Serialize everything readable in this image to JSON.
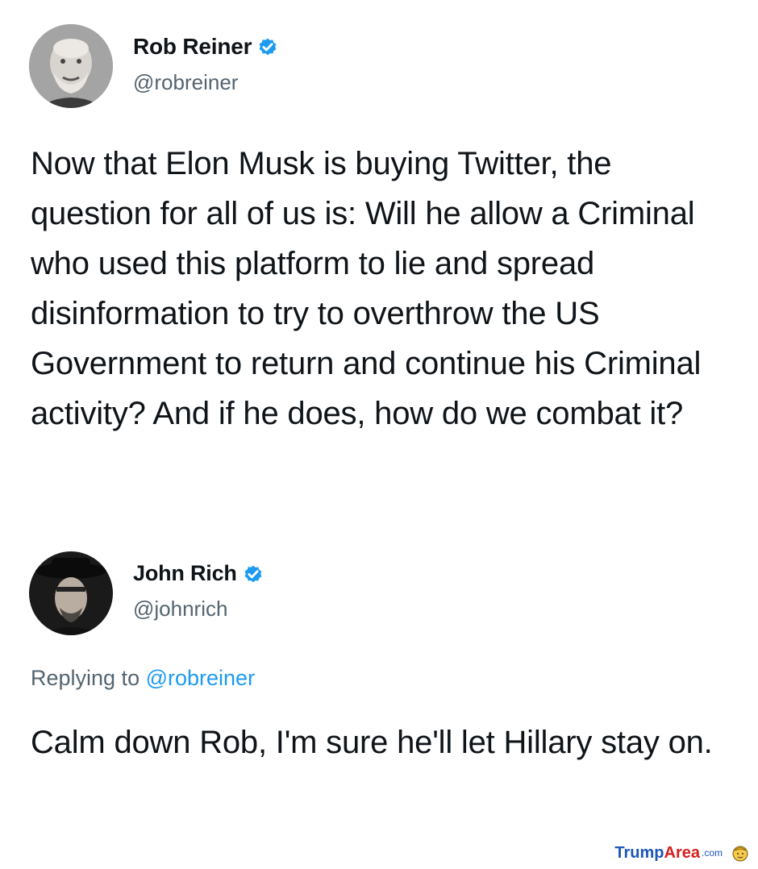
{
  "tweet1": {
    "display_name": "Rob Reiner",
    "handle": "@robreiner",
    "text": "Now that Elon Musk is buying Twitter, the question for all of us is: Will he allow a Criminal who used this platform to lie and spread disinformation to try to overthrow the US Government to return and continue his Criminal activity? And if he does, how do we combat it?"
  },
  "tweet2": {
    "display_name": "John Rich",
    "handle": "@johnrich",
    "replying_prefix": "Replying to ",
    "replying_to": "@robreiner",
    "text": "Calm down Rob, I'm sure he'll let Hillary stay on."
  },
  "watermark": {
    "part1": "Trump",
    "part2": "Area",
    "part3": ".com"
  },
  "icons": {
    "verified": "verified-badge-icon",
    "logo": "trumparea-logo-icon"
  },
  "colors": {
    "verified_blue": "#1d9bf0",
    "secondary_text": "#536471"
  }
}
